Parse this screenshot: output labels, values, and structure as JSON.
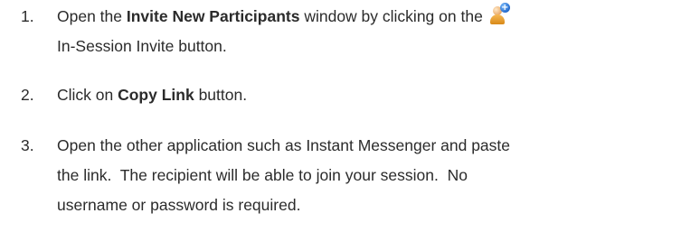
{
  "instructions": {
    "steps": [
      {
        "number": "1.",
        "line1_before": "Open the ",
        "line1_bold": "Invite New Participants",
        "line1_after": " window by clicking on the ",
        "icon": "invite-participant-icon",
        "line2": "In-Session Invite button."
      },
      {
        "number": "2.",
        "before": "Click on ",
        "bold": "Copy Link",
        "after": " button."
      },
      {
        "number": "3.",
        "line1": "Open the other application such as Instant Messenger and paste",
        "line2": "the link.  The recipient will be able to join your session.  No",
        "line3": "username or password is required."
      }
    ],
    "icon_glyph": "+",
    "colors": {
      "text": "#2b2b2b",
      "icon_person": "#e8a868",
      "icon_badge": "#1d63c7"
    }
  }
}
